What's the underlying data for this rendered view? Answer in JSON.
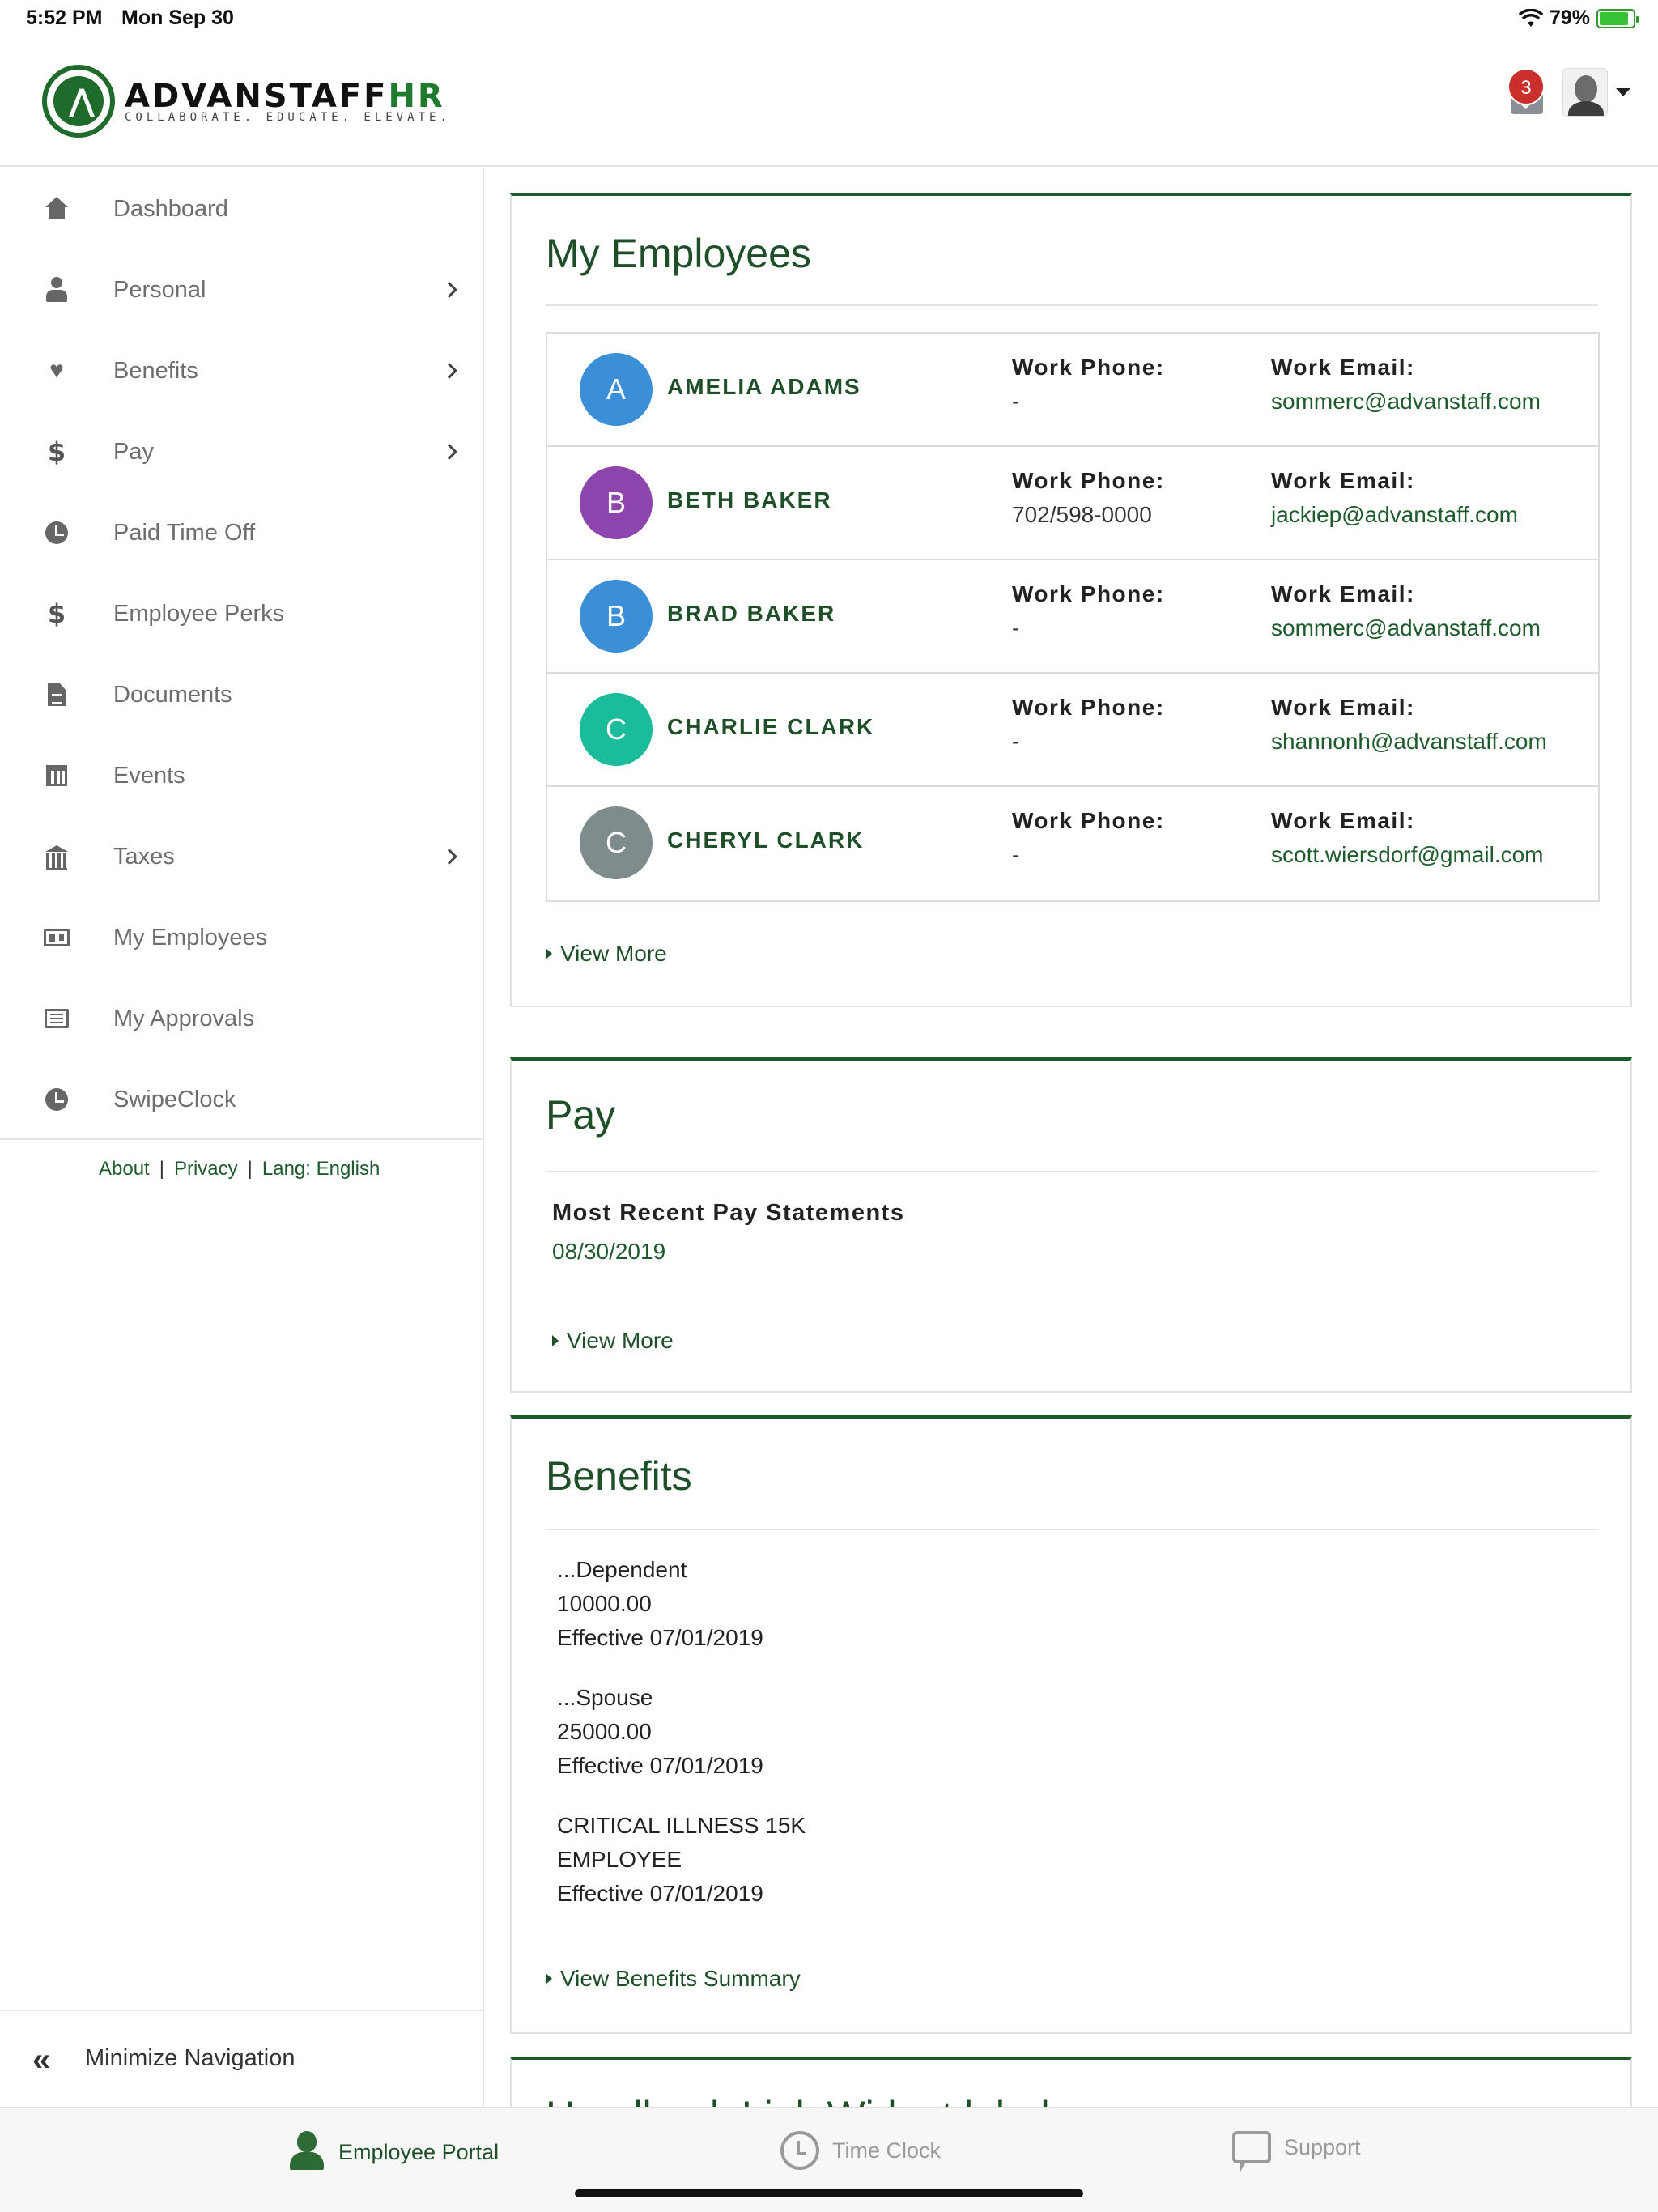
{
  "status_bar": {
    "time": "5:52 PM",
    "date": "Mon Sep 30",
    "battery": "79%",
    "battery_level": 0.79
  },
  "header": {
    "logo": {
      "name_main": "ADVANSTAFF",
      "name_accent": "HR",
      "tagline": "COLLABORATE. EDUCATE. ELEVATE."
    },
    "notifications_count": "3",
    "brand_color": "#1e5b2c"
  },
  "sidebar": {
    "items": [
      {
        "label": "Dashboard",
        "icon": "home-icon",
        "has_submenu": false
      },
      {
        "label": "Personal",
        "icon": "user-icon",
        "has_submenu": true
      },
      {
        "label": "Benefits",
        "icon": "heartbeat-icon",
        "has_submenu": true
      },
      {
        "label": "Pay",
        "icon": "dollar-icon",
        "has_submenu": true
      },
      {
        "label": "Paid Time Off",
        "icon": "clock-icon",
        "has_submenu": false
      },
      {
        "label": "Employee Perks",
        "icon": "dollar-icon",
        "has_submenu": false
      },
      {
        "label": "Documents",
        "icon": "document-icon",
        "has_submenu": false
      },
      {
        "label": "Events",
        "icon": "calendar-icon",
        "has_submenu": false
      },
      {
        "label": "Taxes",
        "icon": "bank-icon",
        "has_submenu": true
      },
      {
        "label": "My Employees",
        "icon": "id-card-icon",
        "has_submenu": false
      },
      {
        "label": "My Approvals",
        "icon": "list-icon",
        "has_submenu": false
      },
      {
        "label": "SwipeClock",
        "icon": "clock-icon",
        "has_submenu": false
      }
    ],
    "footer_links": {
      "about": "About",
      "privacy": "Privacy",
      "lang": "Lang: English",
      "separator": "|"
    },
    "minimize": {
      "icon_glyph": "«",
      "label": "Minimize Navigation"
    }
  },
  "my_employees": {
    "title": "My Employees",
    "phone_label": "Work Phone:",
    "email_label": "Work Email:",
    "employees": [
      {
        "initial": "A",
        "name": "AMELIA ADAMS",
        "phone": "-",
        "email": "sommerc@advanstaff.com",
        "color": "#3a8fd6"
      },
      {
        "initial": "B",
        "name": "BETH BAKER",
        "phone": "702/598-0000",
        "email": "jackiep@advanstaff.com",
        "color": "#8e44ad"
      },
      {
        "initial": "B",
        "name": "BRAD BAKER",
        "phone": "-",
        "email": "sommerc@advanstaff.com",
        "color": "#3a8fd6"
      },
      {
        "initial": "C",
        "name": "CHARLIE CLARK",
        "phone": "-",
        "email": "shannonh@advanstaff.com",
        "color": "#1abc9c"
      },
      {
        "initial": "C",
        "name": "CHERYL CLARK",
        "phone": "-",
        "email": "scott.wiersdorf@gmail.com",
        "color": "#7f8c8d"
      }
    ],
    "view_more": "View More"
  },
  "pay": {
    "title": "Pay",
    "heading": "Most Recent Pay Statements",
    "date": "08/30/2019",
    "view_more": "View More"
  },
  "benefits": {
    "title": "Benefits",
    "items": [
      {
        "line1": "...Dependent",
        "line2": "10000.00",
        "line3": "Effective 07/01/2019"
      },
      {
        "line1": "...Spouse",
        "line2": "25000.00",
        "line3": "Effective 07/01/2019"
      },
      {
        "line1": "CRITICAL ILLNESS 15K",
        "line2": "EMPLOYEE",
        "line3": "Effective 07/01/2019"
      }
    ],
    "view_summary": "View Benefits Summary"
  },
  "next_panel": {
    "title": "Handbook Link Widget label..."
  },
  "tabbar": {
    "tabs": [
      {
        "label": "Employee Portal",
        "icon": "employee-icon",
        "active": true
      },
      {
        "label": "Time Clock",
        "icon": "timer-icon",
        "active": false
      },
      {
        "label": "Support",
        "icon": "chat-icon",
        "active": false
      }
    ]
  }
}
